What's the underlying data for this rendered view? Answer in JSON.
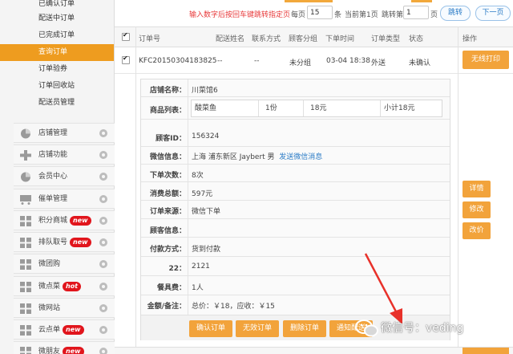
{
  "sidebar": {
    "sub_items": [
      {
        "label": "已确认订单"
      },
      {
        "label": "配送中订单"
      },
      {
        "label": "已完成订单"
      },
      {
        "label": "查询订单",
        "active": true
      },
      {
        "label": "订单验券"
      },
      {
        "label": "订单回收站"
      },
      {
        "label": "配送员管理"
      }
    ],
    "menu": [
      {
        "label": "店铺管理",
        "icon": "pie-chart-icon"
      },
      {
        "label": "店铺功能",
        "icon": "plus-icon"
      },
      {
        "label": "会员中心",
        "icon": "pie-chart-icon"
      },
      {
        "label": "催单管理",
        "icon": "cart-icon"
      },
      {
        "label": "积分商城",
        "icon": "grid-icon",
        "badge": "new"
      },
      {
        "label": "排队取号",
        "icon": "grid-icon",
        "badge": "new"
      },
      {
        "label": "微团购",
        "icon": "grid-icon"
      },
      {
        "label": "微点菜",
        "icon": "grid-icon",
        "badge": "hot"
      },
      {
        "label": "微网站",
        "icon": "grid-icon"
      },
      {
        "label": "云点单",
        "icon": "grid-icon",
        "badge": "new"
      },
      {
        "label": "微朋友",
        "icon": "grid-icon",
        "badge": "new"
      }
    ]
  },
  "toolbar": {
    "hint": "输入数字后按回车键跳转指定页",
    "per_page_label": "每页",
    "per_page_value": "15",
    "per_page_unit": "条",
    "current_page": "当前第1页",
    "jump_label": "跳转第",
    "jump_value": "1",
    "jump_unit": "页",
    "jump_button": "跳转",
    "next_button": "下一页"
  },
  "table": {
    "headers": [
      "订单号",
      "配送姓名",
      "联系方式",
      "顾客分组",
      "下单时间",
      "订单类型",
      "状态",
      "操作"
    ],
    "row": {
      "order_no": "KFC20150304183825",
      "delivery_name": "--",
      "contact": "--",
      "group": "未分组",
      "time": "03-04 18:38",
      "type": "外送",
      "status": "未确认",
      "print_button": "无线打印"
    }
  },
  "detail": {
    "store_label": "店铺名称：",
    "store_value": "川菜馆6",
    "goods_label": "商品列表：",
    "goods": {
      "name": "酸菜鱼",
      "qty": "1份",
      "price": "18元",
      "subtotal": "小计18元"
    },
    "customer_id_label": "顾客ID：",
    "customer_id": "156324",
    "wechat_label": "微信信息：",
    "wechat_value": "上海 浦东新区 Jaybert 男",
    "wechat_link": "发送微信消息",
    "order_count_label": "下单次数：",
    "order_count": "8次",
    "total_spend_label": "消费总额：",
    "total_spend": "597元",
    "source_label": "订单来源：",
    "source": "微信下单",
    "customer_info_label": "顾客信息：",
    "customer_info": "",
    "pay_label": "付款方式：",
    "pay_value": "货到付款",
    "code_label": "22：",
    "code_value": "2121",
    "diners_label": "餐具费：",
    "diners_value": "1人",
    "amount_label": "金额/备注：",
    "amount_value": "总价：￥18，应收：￥15",
    "actions": [
      "确认订单",
      "无效订单",
      "删除订单",
      "通知配送"
    ]
  },
  "side_actions": [
    "详情",
    "修改",
    "改价"
  ],
  "watermark": "微信号：veding",
  "colors": {
    "accent": "#f2a33b",
    "active_menu": "#ee9c1f",
    "hint_red": "#e8393a",
    "link_blue": "#2a7bc6",
    "badge_red": "#e1151c",
    "arrow_red": "#e8312a"
  }
}
